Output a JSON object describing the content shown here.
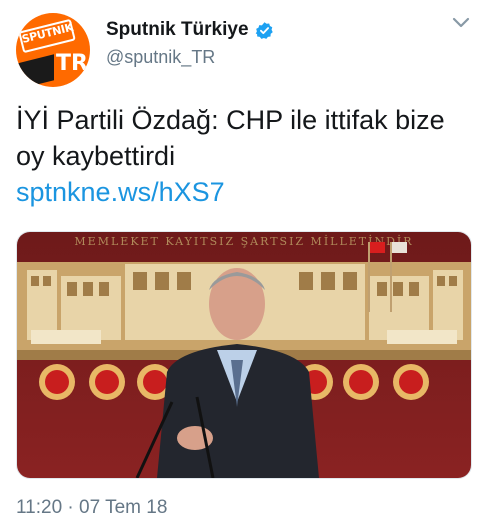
{
  "account": {
    "display_name": "Sputnik Türkiye",
    "handle": "@sputnik_TR",
    "avatar_brand": "SPUTNIK",
    "avatar_badge": "TR",
    "verified_icon": "verified-badge-icon",
    "verified_color": "#1da1f2",
    "brand_color": "#ff6a00"
  },
  "tweet": {
    "text": "İYİ Partili Özdağ: CHP ile ittifak bize oy kaybettirdi",
    "link": "sptnkne.ws/hXS7",
    "link_color": "#1b95e0",
    "timestamp": "11:20 · 07 Tem 18"
  },
  "media": {
    "description_icon": "photo",
    "banner_text": "MEMLEKET KAYITSIZ ŞARTSIZ MİLLETİNDİR"
  },
  "menu": {
    "icon": "chevron-down-icon"
  }
}
